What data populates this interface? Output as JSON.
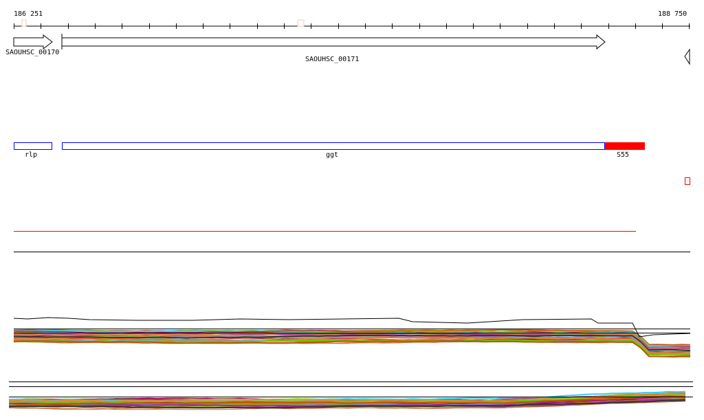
{
  "ruler": {
    "start_label": "186 251",
    "end_label": "188 750"
  },
  "genes": [
    {
      "label": "SAOUHSC_00170",
      "strand": "+"
    },
    {
      "label": "SAOUHSC_00171",
      "strand": "+"
    },
    {
      "label": "",
      "strand": "-"
    }
  ],
  "features": [
    {
      "label": "rlp",
      "color": "#0000ff"
    },
    {
      "label": "ggt",
      "color": "#0000ff"
    },
    {
      "label": "S55",
      "color": "#ff0000"
    }
  ],
  "colors": {
    "accent_red": "#ff0000",
    "track_palette": [
      "#cc6633",
      "#999900",
      "#993399",
      "#66aaee",
      "#ff6633",
      "#66cc00",
      "#aa0066",
      "#cc9933",
      "#333333",
      "#99cc33",
      "#ee7744",
      "#bb5500",
      "#8888cc",
      "#33ccff"
    ]
  }
}
